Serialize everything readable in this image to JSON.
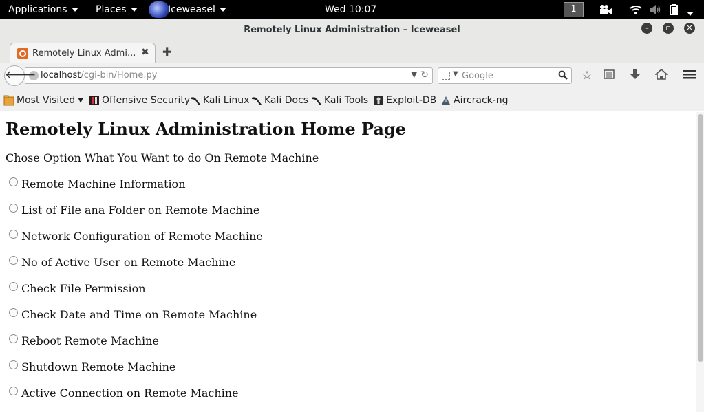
{
  "panel": {
    "applications": "Applications",
    "places": "Places",
    "app_name": "Iceweasel",
    "clock": "Wed 10:07",
    "workspace": "1"
  },
  "window": {
    "title": "Remotely Linux Administration – Iceweasel"
  },
  "tab": {
    "label": "Remotely Linux Admi...",
    "close": "✖"
  },
  "nav": {
    "url_host": "localhost",
    "url_path": "/cgi-bin/Home.py",
    "search_placeholder": "Google"
  },
  "bookmarks": [
    {
      "label": "Most Visited ▾",
      "icon": "most-visited-icon"
    },
    {
      "label": "Offensive Security",
      "icon": "offensive-security-icon"
    },
    {
      "label": "Kali Linux",
      "icon": "kali-dragon-icon"
    },
    {
      "label": "Kali Docs",
      "icon": "kali-dragon-icon"
    },
    {
      "label": "Kali Tools",
      "icon": "kali-dragon-icon"
    },
    {
      "label": "Exploit-DB",
      "icon": "exploit-db-icon"
    },
    {
      "label": "Aircrack-ng",
      "icon": "aircrack-icon"
    }
  ],
  "page": {
    "heading": "Remotely Linux Administration Home Page",
    "lead": "Chose Option What You Want to do On Remote Machine",
    "options": [
      "Remote Machine Information",
      "List of File ana Folder on Remote Machine",
      "Network Configuration of Remote Machine",
      "No of Active User on Remote Machine",
      "Check File Permission",
      "Check Date and Time on Remote Machine",
      "Reboot Remote Machine",
      "Shutdown Remote Machine",
      "Active Connection on Remote Machine"
    ]
  }
}
